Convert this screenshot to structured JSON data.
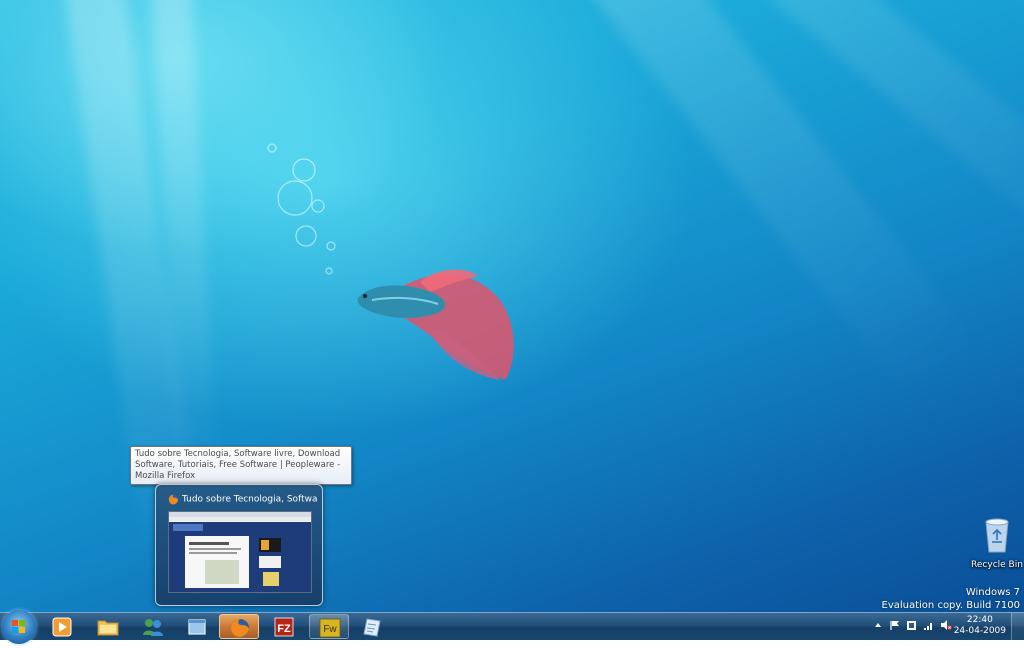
{
  "desktop": {
    "recycle_bin_label": "Recycle Bin",
    "watermark_line1": "Windows 7",
    "watermark_line2": "Evaluation copy. Build 7100"
  },
  "tooltip": {
    "text": "Tudo sobre Tecnologia, Software livre, Download Software, Tutoriais, Free Software | Peopleware - Mozilla Firefox"
  },
  "preview": {
    "title": "Tudo sobre Tecnologia, Softwar..."
  },
  "taskbar": {
    "items": [
      {
        "name": "media-player",
        "icon": "media-player-icon"
      },
      {
        "name": "windows-explorer",
        "icon": "folder-icon"
      },
      {
        "name": "messenger",
        "icon": "messenger-icon"
      },
      {
        "name": "desktop-switcher",
        "icon": "window-icon"
      },
      {
        "name": "firefox",
        "icon": "firefox-icon",
        "state": "active"
      },
      {
        "name": "filezilla",
        "icon": "filezilla-icon"
      },
      {
        "name": "fireworks",
        "icon": "fireworks-icon",
        "state": "running",
        "label": "Fw"
      },
      {
        "name": "notepad",
        "icon": "note-icon"
      }
    ],
    "filezilla_label": "FZ"
  },
  "tray": {
    "time": "22:40",
    "date": "24-04-2009",
    "icons": [
      "chevron-up-icon",
      "flag-icon",
      "network-device-icon",
      "signal-icon",
      "speaker-muted-icon"
    ]
  },
  "colors": {
    "taskbar": "#1c4a75",
    "active_button": "#c97a35",
    "desktop_top": "#33c3e6",
    "desktop_bottom": "#0a4f98"
  }
}
